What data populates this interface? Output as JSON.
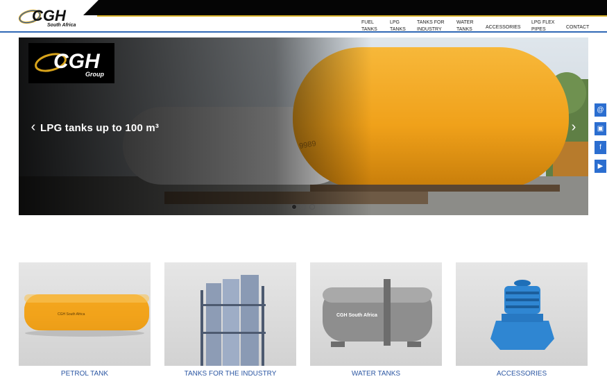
{
  "brand": {
    "name": "CGH",
    "subtitle": "South Africa",
    "slider_logo": "CGH",
    "slider_logo_sub": "Group"
  },
  "nav": [
    {
      "label": "FUEL\nTANKS"
    },
    {
      "label": "LPG\nTANKS"
    },
    {
      "label": "TANKS FOR\nINDUSTRY"
    },
    {
      "label": "WATER\nTANKS"
    },
    {
      "label": "ACCESSORIES"
    },
    {
      "label": "LPG FLEX\nPIPES"
    },
    {
      "label": "CONTACT"
    }
  ],
  "slider": {
    "caption": "LPG tanks up to 100 m³",
    "tank_text": "9989",
    "prev_icon": "chevron-left-icon",
    "next_icon": "chevron-right-icon",
    "dots": 3,
    "active_dot": 0
  },
  "social": [
    {
      "icon": "email-icon",
      "glyph": "@"
    },
    {
      "icon": "contact-card-icon",
      "glyph": "▣"
    },
    {
      "icon": "facebook-icon",
      "glyph": "f"
    },
    {
      "icon": "youtube-icon",
      "glyph": "▶"
    }
  ],
  "products": [
    {
      "label": "PETROL TANK",
      "tank_text": "CGH South Africa"
    },
    {
      "label": "TANKS FOR THE INDUSTRY"
    },
    {
      "label": "WATER TANKS",
      "tank_text": "CGH South Africa"
    },
    {
      "label": "ACCESSORIES"
    }
  ],
  "colors": {
    "accent": "#2f68b5",
    "gold": "#d8b22a",
    "tank_orange": "#f2a31b",
    "link": "#2c57a3"
  }
}
